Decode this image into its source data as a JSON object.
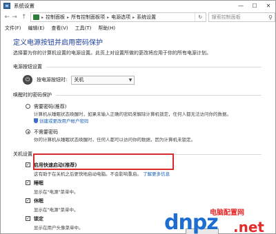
{
  "window": {
    "title": "系统设置"
  },
  "address": {
    "crumbs": [
      "控制面板",
      "所有控制面板项",
      "电源选项",
      "系统设置"
    ],
    "search_placeholder": "搜索控制面板"
  },
  "menu": [
    "文件(F)",
    "编辑(E)",
    "查看(V)",
    "工具(T)",
    "帮助(H)"
  ],
  "page": {
    "title": "定义电源按钮并启用密码保护",
    "description": "选择要为你的计算机设置的电源设置。此页上对设置所做的更改将应用于你的所有电源计划。"
  },
  "power_button": {
    "section": "电源按钮设置",
    "label": "按电源按钮时:",
    "value": "关机"
  },
  "wake_password": {
    "section": "唤醒时的密码保护",
    "options": [
      {
        "label": "需要密码(推荐)",
        "desc": "计算机从睡眠状态唤醒时，如果未输入正确的密码来解除计算机锁定，任何人都无法访问你的数据。",
        "link": "创建或更改用户帐户密码",
        "selected": false
      },
      {
        "label": "不需要密码",
        "desc": "你的计算机从睡眠状态唤醒时，任何人都可以访问你的数据，因为计算机未锁定。",
        "selected": true
      }
    ]
  },
  "shutdown": {
    "section": "关机设置",
    "items": [
      {
        "label": "启用快速启动(推荐)",
        "desc": "这有助于在关机之后更快地启动电脑。不会影响重启。",
        "link": "了解更多信息",
        "checked": true,
        "bold": true
      },
      {
        "label": "睡眠",
        "desc": "显示在\"电源\"菜单中。",
        "checked": true
      },
      {
        "label": "休眠",
        "desc": "显示在\"电源\"菜单中。",
        "checked": true
      },
      {
        "label": "锁定",
        "desc": "显示在用户头像菜单中。",
        "checked": true
      }
    ]
  },
  "watermark": {
    "main": "dnpz",
    "sub": "电脑配置网",
    "tld": ".net"
  }
}
